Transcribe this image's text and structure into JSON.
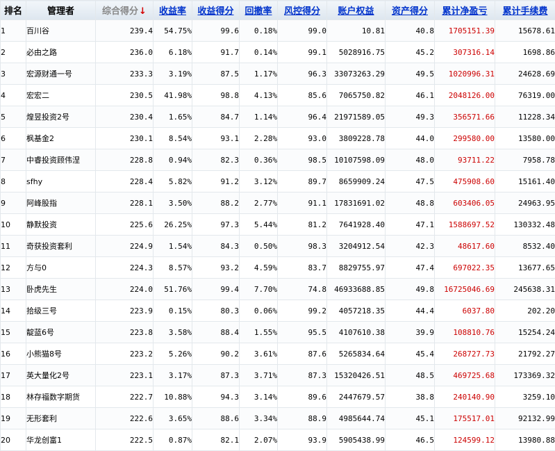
{
  "table": {
    "headers": {
      "rank": "排名",
      "manager": "管理者",
      "total_score": "综合得分",
      "return_rate": "收益率",
      "return_score": "收益得分",
      "drawdown": "回撤率",
      "risk_score": "风控得分",
      "equity": "账户权益",
      "asset_score": "资产得分",
      "cum_pnl": "累计净盈亏",
      "cum_fee": "累计手续费"
    },
    "sorted_column": "total_score",
    "sort_direction": "desc",
    "rows": [
      {
        "rank": "1",
        "manager": "百川谷",
        "total_score": "239.4",
        "return_rate": "54.75%",
        "return_score": "99.6",
        "drawdown": "0.18%",
        "risk_score": "99.0",
        "equity": "10.81",
        "asset_score": "40.8",
        "cum_pnl": "1705151.39",
        "cum_fee": "15678.61"
      },
      {
        "rank": "2",
        "manager": "必由之路",
        "total_score": "236.0",
        "return_rate": "6.18%",
        "return_score": "91.7",
        "drawdown": "0.14%",
        "risk_score": "99.1",
        "equity": "5028916.75",
        "asset_score": "45.2",
        "cum_pnl": "307316.14",
        "cum_fee": "1698.86"
      },
      {
        "rank": "3",
        "manager": "宏源财通一号",
        "total_score": "233.3",
        "return_rate": "3.19%",
        "return_score": "87.5",
        "drawdown": "1.17%",
        "risk_score": "96.3",
        "equity": "33073263.29",
        "asset_score": "49.5",
        "cum_pnl": "1020996.31",
        "cum_fee": "24628.69"
      },
      {
        "rank": "4",
        "manager": "宏宏二",
        "total_score": "230.5",
        "return_rate": "41.98%",
        "return_score": "98.8",
        "drawdown": "4.13%",
        "risk_score": "85.6",
        "equity": "7065750.82",
        "asset_score": "46.1",
        "cum_pnl": "2048126.00",
        "cum_fee": "76319.00"
      },
      {
        "rank": "5",
        "manager": "煌昱投资2号",
        "total_score": "230.4",
        "return_rate": "1.65%",
        "return_score": "84.7",
        "drawdown": "1.14%",
        "risk_score": "96.4",
        "equity": "21971589.05",
        "asset_score": "49.3",
        "cum_pnl": "356571.66",
        "cum_fee": "11228.34"
      },
      {
        "rank": "6",
        "manager": "枫基金2",
        "total_score": "230.1",
        "return_rate": "8.54%",
        "return_score": "93.1",
        "drawdown": "2.28%",
        "risk_score": "93.0",
        "equity": "3809228.78",
        "asset_score": "44.0",
        "cum_pnl": "299580.00",
        "cum_fee": "13580.00"
      },
      {
        "rank": "7",
        "manager": "中睿投资顾伟涅",
        "total_score": "228.8",
        "return_rate": "0.94%",
        "return_score": "82.3",
        "drawdown": "0.36%",
        "risk_score": "98.5",
        "equity": "10107598.09",
        "asset_score": "48.0",
        "cum_pnl": "93711.22",
        "cum_fee": "7958.78"
      },
      {
        "rank": "8",
        "manager": "sfhy",
        "total_score": "228.4",
        "return_rate": "5.82%",
        "return_score": "91.2",
        "drawdown": "3.12%",
        "risk_score": "89.7",
        "equity": "8659909.24",
        "asset_score": "47.5",
        "cum_pnl": "475908.60",
        "cum_fee": "15161.40"
      },
      {
        "rank": "9",
        "manager": "阿峰股指",
        "total_score": "228.1",
        "return_rate": "3.50%",
        "return_score": "88.2",
        "drawdown": "2.77%",
        "risk_score": "91.1",
        "equity": "17831691.02",
        "asset_score": "48.8",
        "cum_pnl": "603406.05",
        "cum_fee": "24963.95"
      },
      {
        "rank": "10",
        "manager": "静默投资",
        "total_score": "225.6",
        "return_rate": "26.25%",
        "return_score": "97.3",
        "drawdown": "5.44%",
        "risk_score": "81.2",
        "equity": "7641928.40",
        "asset_score": "47.1",
        "cum_pnl": "1588697.52",
        "cum_fee": "130332.48"
      },
      {
        "rank": "11",
        "manager": "奇获投资套利",
        "total_score": "224.9",
        "return_rate": "1.54%",
        "return_score": "84.3",
        "drawdown": "0.50%",
        "risk_score": "98.3",
        "equity": "3204912.54",
        "asset_score": "42.3",
        "cum_pnl": "48617.60",
        "cum_fee": "8532.40"
      },
      {
        "rank": "12",
        "manager": "方与0",
        "total_score": "224.3",
        "return_rate": "8.57%",
        "return_score": "93.2",
        "drawdown": "4.59%",
        "risk_score": "83.7",
        "equity": "8829755.97",
        "asset_score": "47.4",
        "cum_pnl": "697022.35",
        "cum_fee": "13677.65"
      },
      {
        "rank": "13",
        "manager": "卧虎先生",
        "total_score": "224.0",
        "return_rate": "51.76%",
        "return_score": "99.4",
        "drawdown": "7.70%",
        "risk_score": "74.8",
        "equity": "46933688.85",
        "asset_score": "49.8",
        "cum_pnl": "16725046.69",
        "cum_fee": "245638.31"
      },
      {
        "rank": "14",
        "manager": "拾级三号",
        "total_score": "223.9",
        "return_rate": "0.15%",
        "return_score": "80.3",
        "drawdown": "0.06%",
        "risk_score": "99.2",
        "equity": "4057218.35",
        "asset_score": "44.4",
        "cum_pnl": "6037.80",
        "cum_fee": "202.20"
      },
      {
        "rank": "15",
        "manager": "靛蓝6号",
        "total_score": "223.8",
        "return_rate": "3.58%",
        "return_score": "88.4",
        "drawdown": "1.55%",
        "risk_score": "95.5",
        "equity": "4107610.38",
        "asset_score": "39.9",
        "cum_pnl": "108810.76",
        "cum_fee": "15254.24"
      },
      {
        "rank": "16",
        "manager": "小熊猫8号",
        "total_score": "223.2",
        "return_rate": "5.26%",
        "return_score": "90.2",
        "drawdown": "3.61%",
        "risk_score": "87.6",
        "equity": "5265834.64",
        "asset_score": "45.4",
        "cum_pnl": "268727.73",
        "cum_fee": "21792.27"
      },
      {
        "rank": "17",
        "manager": "英大量化2号",
        "total_score": "223.1",
        "return_rate": "3.17%",
        "return_score": "87.3",
        "drawdown": "3.71%",
        "risk_score": "87.3",
        "equity": "15320426.51",
        "asset_score": "48.5",
        "cum_pnl": "469725.68",
        "cum_fee": "173369.32"
      },
      {
        "rank": "18",
        "manager": "林存福数字期货",
        "total_score": "222.7",
        "return_rate": "10.88%",
        "return_score": "94.3",
        "drawdown": "3.14%",
        "risk_score": "89.6",
        "equity": "2447679.57",
        "asset_score": "38.8",
        "cum_pnl": "240140.90",
        "cum_fee": "3259.10"
      },
      {
        "rank": "19",
        "manager": "无形套利",
        "total_score": "222.6",
        "return_rate": "3.65%",
        "return_score": "88.6",
        "drawdown": "3.34%",
        "risk_score": "88.9",
        "equity": "4985644.74",
        "asset_score": "45.1",
        "cum_pnl": "175517.01",
        "cum_fee": "92132.99"
      },
      {
        "rank": "20",
        "manager": "华龙创富1",
        "total_score": "222.5",
        "return_rate": "0.87%",
        "return_score": "82.1",
        "drawdown": "2.07%",
        "risk_score": "93.9",
        "equity": "5905438.99",
        "asset_score": "46.5",
        "cum_pnl": "124599.12",
        "cum_fee": "13980.88"
      }
    ]
  },
  "colors": {
    "link_blue": "#0033cc",
    "pnl_red": "#cc0000",
    "sort_arrow_red": "#d40000",
    "active_header_gray": "#888888"
  },
  "icons": {
    "sort": "sort-desc-arrow-icon"
  }
}
